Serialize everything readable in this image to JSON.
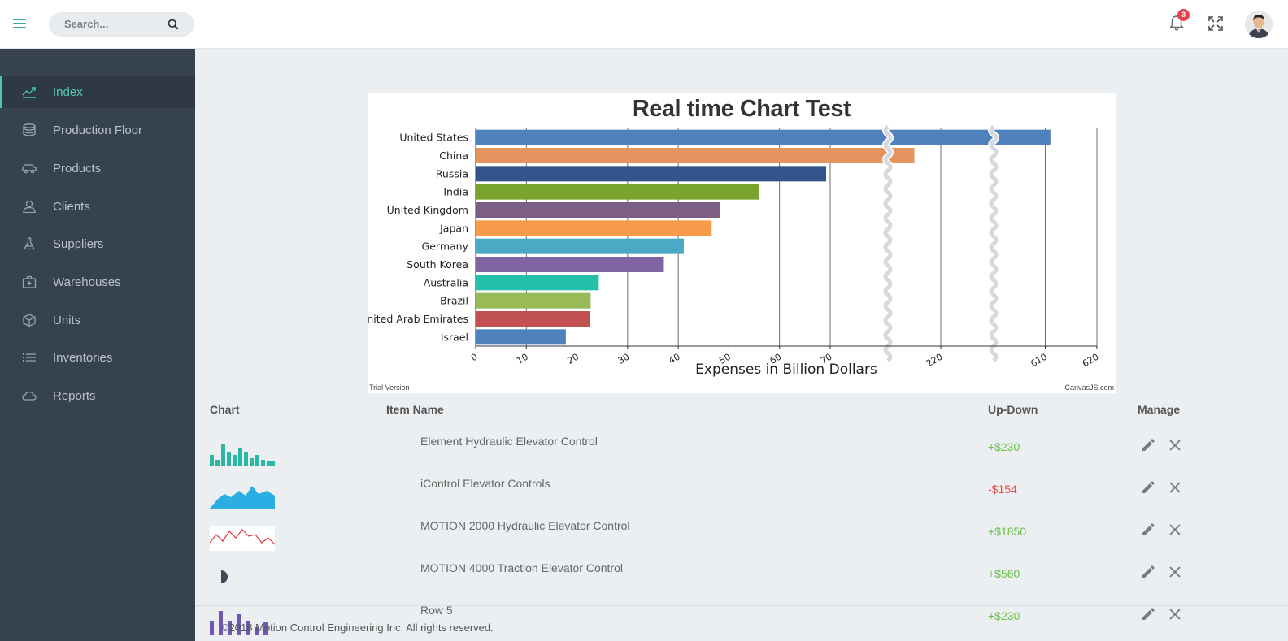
{
  "header": {
    "search_placeholder": "Search...",
    "notifications_count": "3"
  },
  "sidebar": {
    "items": [
      {
        "label": "Index",
        "icon": "trending-up-icon",
        "active": true
      },
      {
        "label": "Production Floor",
        "icon": "database-icon"
      },
      {
        "label": "Products",
        "icon": "car-icon"
      },
      {
        "label": "Clients",
        "icon": "user-icon"
      },
      {
        "label": "Suppliers",
        "icon": "flask-icon"
      },
      {
        "label": "Warehouses",
        "icon": "first-aid-kit-icon"
      },
      {
        "label": "Units",
        "icon": "cube-icon"
      },
      {
        "label": "Inventories",
        "icon": "list-icon"
      },
      {
        "label": "Reports",
        "icon": "cloud-icon"
      }
    ]
  },
  "chart_data": {
    "type": "bar",
    "orientation": "horizontal",
    "title": "Real time Chart Test",
    "xlabel": "Expenses in Billion Dollars",
    "ylabel": "",
    "categories": [
      "United States",
      "China",
      "Russia",
      "India",
      "United Kingdom",
      "Japan",
      "Germany",
      "South Korea",
      "Australia",
      "Brazil",
      "United Arab Emirates",
      "Israel"
    ],
    "values": [
      611,
      215,
      69.2,
      55.9,
      48.3,
      46.6,
      41.1,
      37,
      24.3,
      22.7,
      22.6,
      17.8
    ],
    "colors": [
      "#4f81bc",
      "#e6945f",
      "#33548a",
      "#78a42e",
      "#7d5f85",
      "#f79a4a",
      "#4aa9c4",
      "#8064a2",
      "#24c0a9",
      "#99bb57",
      "#c15151",
      "#4f81bc"
    ],
    "xticks": [
      "0",
      "10",
      "20",
      "30",
      "40",
      "50",
      "60",
      "70",
      "220",
      "610",
      "620"
    ],
    "scale_breaks": [
      [
        70,
        210
      ],
      [
        220,
        600
      ]
    ],
    "xlim": [
      0,
      620
    ],
    "grid": true,
    "watermark_left": "Trial Version",
    "watermark_right": "CanvasJS.com"
  },
  "table": {
    "headers": {
      "chart": "Chart",
      "item_name": "Item Name",
      "updown": "Up-Down",
      "manage": "Manage"
    },
    "rows": [
      {
        "name": "Element Hydraulic Elevator Control",
        "updown": "+$230",
        "trend": "positive",
        "spark": "bars-teal"
      },
      {
        "name": "iControl Elevator Controls",
        "updown": "-$154",
        "trend": "negative",
        "spark": "area-blue"
      },
      {
        "name": "MOTION 2000 Hydraulic Elevator Control",
        "updown": "+$1850",
        "trend": "positive",
        "spark": "line-red"
      },
      {
        "name": "MOTION 4000 Traction Elevator Control",
        "updown": "+$560",
        "trend": "positive",
        "spark": "pie-dark"
      },
      {
        "name": "Row 5",
        "updown": "+$230",
        "trend": "positive",
        "spark": "bars-purple"
      }
    ]
  },
  "footer": {
    "text": "©2018 Motion Control Engineering Inc. All rights reserved."
  }
}
